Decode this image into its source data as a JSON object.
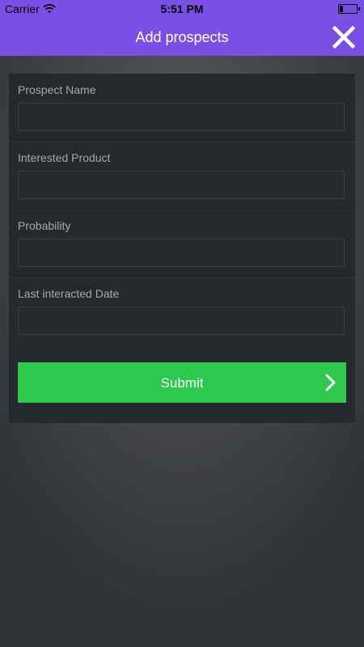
{
  "status_bar": {
    "carrier": "Carrier",
    "time": "5:51 PM",
    "battery_level": 0.2
  },
  "header": {
    "title": "Add prospects",
    "close_icon": "close-icon"
  },
  "form": {
    "fields": [
      {
        "label": "Prospect Name",
        "value": "",
        "placeholder": ""
      },
      {
        "label": "Interested Product",
        "value": "",
        "placeholder": ""
      },
      {
        "label": "Probability",
        "value": "",
        "placeholder": ""
      },
      {
        "label": "Last interacted Date",
        "value": "",
        "placeholder": ""
      }
    ],
    "submit_label": "Submit",
    "submit_icon": "chevron-right-icon"
  },
  "colors": {
    "header_bg": "#7a4fe3",
    "card_bg": "#25282d",
    "submit_bg": "#2dc84d",
    "label_text": "#a7a9ac"
  }
}
